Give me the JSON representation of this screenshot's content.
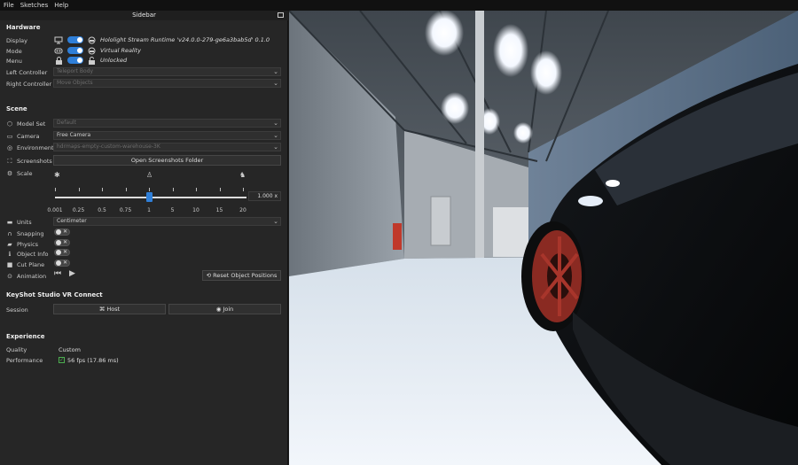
{
  "menu": {
    "items": [
      "File",
      "Sketches",
      "Help"
    ]
  },
  "sidebar": {
    "title": "Sidebar",
    "hardware": {
      "heading": "Hardware",
      "display": {
        "label": "Display",
        "value": "Hololight Stream Runtime 'v24.0.0-279-ge6a3bab5d' 0.1.0",
        "icon": "monitor-icon",
        "icon2": "headset-icon"
      },
      "mode": {
        "label": "Mode",
        "value": "Virtual Reality",
        "icon": "vr-goggles-icon",
        "icon2": "headset-icon"
      },
      "menu": {
        "label": "Menu",
        "value": "Unlocked",
        "icon": "lock-icon",
        "icon2": "unlock-icon"
      },
      "left_controller": {
        "label": "Left Controller",
        "value": "Teleport Body"
      },
      "right_controller": {
        "label": "Right Controller",
        "value": "Move Objects"
      }
    },
    "scene": {
      "heading": "Scene",
      "model_set": {
        "label": "Model Set",
        "value": "Default"
      },
      "camera": {
        "label": "Camera",
        "value": "Free Camera"
      },
      "environment": {
        "label": "Environment",
        "value": "hdrmaps-empty-custom-warehouse-3K"
      },
      "screenshots": {
        "label": "Screenshots",
        "button": "Open Screenshots Folder"
      },
      "scale": {
        "label": "Scale",
        "value_display": "1.000 x",
        "ticks": [
          "0.001",
          "0.25",
          "0.5",
          "0.75",
          "1",
          "5",
          "10",
          "15",
          "20"
        ],
        "current": 1
      },
      "units": {
        "label": "Units",
        "value": "Centimeter"
      },
      "snapping": {
        "label": "Snapping"
      },
      "physics": {
        "label": "Physics"
      },
      "object_info": {
        "label": "Object Info"
      },
      "cut_plane": {
        "label": "Cut Plane"
      },
      "animation": {
        "label": "Animation",
        "reset_button": "Reset Object Positions"
      }
    },
    "vr_connect": {
      "heading": "KeyShot Studio VR Connect",
      "session": {
        "label": "Session",
        "host_button": "Host",
        "join_button": "Join"
      }
    },
    "experience": {
      "heading": "Experience",
      "quality": {
        "label": "Quality",
        "value": "Custom"
      },
      "performance": {
        "label": "Performance",
        "value": "56 fps (17.86 ms)"
      }
    }
  },
  "viewport": {
    "scene": "warehouse with black car"
  }
}
